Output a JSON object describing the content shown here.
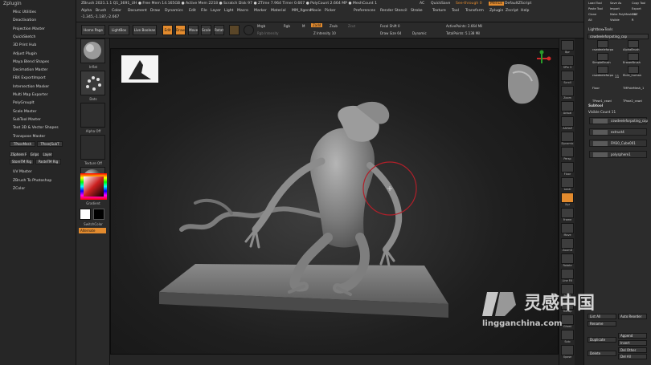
{
  "left_panel": {
    "title": "Zplugin",
    "items": [
      "Misc Utilities",
      "Deactivation",
      "Projection Master",
      "QuickSketch",
      "3D Print Hub",
      "Adjust Plugin",
      "Maya Blend Shapes",
      "Decimation Master",
      "FBX ExportImport",
      "Intersection Masker",
      "Multi Map Exporter",
      "PolyGroupIt",
      "Scale Master",
      "SubTool Master",
      "Text 3D & Vector Shapes",
      "Transpose Master"
    ],
    "buttons": [
      "TPoseMesh",
      "TPose|SubT",
      "ZSphere Rig",
      "Grips",
      "Layer",
      "StoreTM Rig",
      "PasteTM Rig"
    ],
    "bottom_items": [
      "UV Master",
      "ZBrush To Photoshop",
      "ZColor"
    ]
  },
  "top_menu": {
    "items": [
      "Alpha",
      "Brush",
      "Color",
      "Document",
      "Draw",
      "Dynamics",
      "Edit",
      "File",
      "Layer",
      "Light",
      "Macro",
      "Marker",
      "Material",
      "MM_Xgens",
      "Movie",
      "Picker",
      "Preferences",
      "Render",
      "Stencil",
      "Stroke",
      "Texture",
      "Tool",
      "Transform",
      "Zplugin",
      "Zscript",
      "Help"
    ],
    "status": "ZBrush 2021.1.1  Q1_3691_UH  ● Free Mem 14.165GB ● Active Mem 2218 ● Scratch Disk 97 ● ZTime 7.964 Timer 0.667 ● PolyCount 2.664 MP ● MeshCount 1",
    "coords": "-1.345,-1.187,-2.667",
    "ac": "AC",
    "quicksave": "QuickSave",
    "see_through": "See-through  0",
    "menus": "Menus",
    "default_zscript": "DefaultZScript"
  },
  "toolbar": {
    "home_page": "Home Page",
    "lightbox": "LightBox",
    "live_boolean": "Live Boolean",
    "edit": "Edit",
    "draw": "Draw",
    "move": "Move",
    "scale": "Scale",
    "rotate": "Rotate",
    "mrgb": "Mrgb",
    "rgb": "Rgb",
    "m": "M",
    "zadd": "Zadd",
    "zsub": "Zsub",
    "zcut": "Zcut",
    "rgb_intensity": "Rgb Intensity",
    "z_intensity": "Z Intensity 10",
    "focal_shift": "Focal Shift 0",
    "draw_size": "Draw Size 64",
    "dynamic": "Dynamic",
    "active_points": "ActivePoints: 2.664 Mil",
    "total_points": "TotalPoints: 5.138 Mil"
  },
  "tool_column": {
    "tiles": [
      "Inflat",
      "Dots",
      "Alpha Off",
      "Texture Off",
      "StartupMaterial"
    ],
    "gradient": "Gradient",
    "switch_color": "SwitchColor",
    "alternate": "Alternate"
  },
  "right_icons": [
    "Bpr",
    "SPix 3",
    "Scroll",
    "Zoom",
    "Actual",
    "AAHalf",
    "Dynamic",
    "Persp",
    "Floor",
    "Local",
    "Xyz",
    "Frame",
    "Move",
    "ZoomD",
    "Rotate",
    "Line Fill",
    "PolyF",
    "Transp",
    "Ghost",
    "Solo",
    "Xpose"
  ],
  "tray": {
    "top_labels": [
      "Load Tool",
      "Save As",
      "Copy Tool",
      "Paste Tool",
      "Import",
      "Export",
      "Clone",
      "Make PolyMesh3D",
      "GoZ",
      "All",
      "Visible",
      "R"
    ],
    "lightbox_tools": "Lightbox▸Tools",
    "current_tool": "cswdeeleforpoting_cop",
    "tools": [
      "cswdeeleforpo",
      "AlphaBrush",
      "SimpleBrush",
      "EraserBrush",
      "cswdeeleforpo",
      "flickt_human",
      "Floor",
      "TMPoleMesh_1",
      "TPose1_cswd",
      "TPose2_cswd"
    ],
    "count": "11",
    "subtool_title": "Subtool",
    "visible_count": "Visible Count 11",
    "subtools": [
      "cswdeeleforpoting_cop",
      "extruct4",
      "FM30_Cube001",
      "polysphere1"
    ],
    "bottom": [
      "List All",
      "Auto Reorder",
      "Rename",
      "Append",
      "Duplicate",
      "Insert",
      "Delete",
      "Del Other",
      "Del All"
    ]
  },
  "canvas": {
    "gizmo_color": "#e38b2e",
    "accent": "#c0202a"
  },
  "watermark": {
    "cn": "灵感中国",
    "url": "lingganchina.com"
  }
}
